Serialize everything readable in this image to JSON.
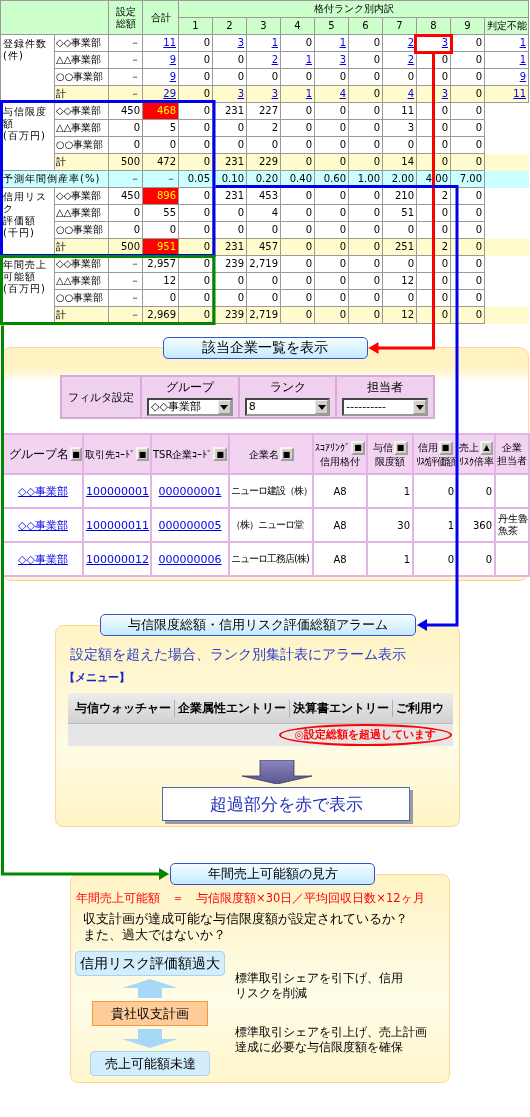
{
  "rank_table": {
    "columns": {
      "setting": "設定総額",
      "total": "合計",
      "breakdown": "格付ランク別内訳",
      "ranks": [
        "1",
        "2",
        "3",
        "4",
        "5",
        "6",
        "7",
        "8",
        "9",
        "判定不能"
      ]
    },
    "sections": [
      {
        "kind": "group",
        "label": [
          "登録件数",
          "(件)"
        ],
        "rows": [
          {
            "dept": "◇◇事業部",
            "subtotal": false,
            "cells": [
              "－",
              {
                "text": "11",
                "link": true
              },
              "0",
              {
                "text": "3",
                "link": true
              },
              {
                "text": "1",
                "link": true
              },
              "0",
              {
                "text": "1",
                "link": true
              },
              "0",
              {
                "text": "2",
                "link": true
              },
              {
                "text": "3",
                "link": true
              },
              "0",
              {
                "text": "1",
                "link": true
              }
            ]
          },
          {
            "dept": "△△事業部",
            "subtotal": false,
            "cells": [
              "－",
              {
                "text": "9",
                "link": true
              },
              "0",
              "0",
              {
                "text": "2",
                "link": true
              },
              {
                "text": "1",
                "link": true
              },
              {
                "text": "3",
                "link": true
              },
              "0",
              {
                "text": "2",
                "link": true
              },
              "0",
              "0",
              {
                "text": "1",
                "link": true
              }
            ]
          },
          {
            "dept": "○○事業部",
            "subtotal": false,
            "cells": [
              "－",
              {
                "text": "9",
                "link": true
              },
              "0",
              "0",
              "0",
              "0",
              "0",
              "0",
              "0",
              "0",
              "0",
              {
                "text": "9",
                "link": true
              }
            ]
          },
          {
            "dept": "計",
            "subtotal": true,
            "cells": [
              "－",
              {
                "text": "29",
                "link": true
              },
              "0",
              {
                "text": "3",
                "link": true
              },
              {
                "text": "3",
                "link": true
              },
              {
                "text": "1",
                "link": true
              },
              {
                "text": "4",
                "link": true
              },
              "0",
              {
                "text": "4",
                "link": true
              },
              {
                "text": "3",
                "link": true
              },
              "0",
              {
                "text": "11",
                "link": true
              }
            ]
          }
        ]
      },
      {
        "kind": "group",
        "label": [
          "与信限度額",
          "(百万円)"
        ],
        "rows": [
          {
            "dept": "◇◇事業部",
            "subtotal": false,
            "cells": [
              "450",
              {
                "text": "468",
                "alert": true
              },
              "0",
              "231",
              "227",
              "0",
              "0",
              "0",
              "11",
              "0",
              "0"
            ]
          },
          {
            "dept": "△△事業部",
            "subtotal": false,
            "cells": [
              "0",
              "5",
              "0",
              "0",
              "2",
              "0",
              "0",
              "0",
              "3",
              "0",
              "0"
            ]
          },
          {
            "dept": "○○事業部",
            "subtotal": false,
            "cells": [
              "0",
              "0",
              "0",
              "0",
              "0",
              "0",
              "0",
              "0",
              "0",
              "0",
              "0"
            ]
          },
          {
            "dept": "計",
            "subtotal": true,
            "cells": [
              "500",
              "472",
              "0",
              "231",
              "229",
              "0",
              "0",
              "0",
              "14",
              "0",
              "0"
            ]
          }
        ]
      },
      {
        "kind": "rate",
        "label": "予測年間倒産率(%)",
        "cells": [
          "－",
          "－",
          "0.05",
          "0.10",
          "0.20",
          "0.40",
          "0.60",
          "1.00",
          "2.00",
          "4.00",
          "7.00"
        ]
      },
      {
        "kind": "group",
        "label": [
          "信用リスク",
          "評価額",
          "(千円)"
        ],
        "rows": [
          {
            "dept": "◇◇事業部",
            "subtotal": false,
            "cells": [
              "450",
              {
                "text": "896",
                "alert": true
              },
              "0",
              "231",
              "453",
              "0",
              "0",
              "0",
              "210",
              "2",
              "0"
            ]
          },
          {
            "dept": "△△事業部",
            "subtotal": false,
            "cells": [
              "0",
              "55",
              "0",
              "0",
              "4",
              "0",
              "0",
              "0",
              "51",
              "0",
              "0"
            ]
          },
          {
            "dept": "○○事業部",
            "subtotal": false,
            "cells": [
              "0",
              "0",
              "0",
              "0",
              "0",
              "0",
              "0",
              "0",
              "0",
              "0",
              "0"
            ]
          },
          {
            "dept": "計",
            "subtotal": true,
            "cells": [
              "500",
              {
                "text": "951",
                "alert": true
              },
              "0",
              "231",
              "457",
              "0",
              "0",
              "0",
              "251",
              "2",
              "0"
            ]
          }
        ]
      },
      {
        "kind": "group",
        "label": [
          "年間売上",
          "可能額",
          "(百万円)"
        ],
        "rows": [
          {
            "dept": "◇◇事業部",
            "subtotal": false,
            "cells": [
              "－",
              "2,957",
              "0",
              "239",
              "2,719",
              "0",
              "0",
              "0",
              "0",
              "0",
              "0"
            ]
          },
          {
            "dept": "△△事業部",
            "subtotal": false,
            "cells": [
              "－",
              "12",
              "0",
              "0",
              "0",
              "0",
              "0",
              "0",
              "12",
              "0",
              "0"
            ]
          },
          {
            "dept": "○○事業部",
            "subtotal": false,
            "cells": [
              "－",
              "0",
              "0",
              "0",
              "0",
              "0",
              "0",
              "0",
              "0",
              "0",
              "0"
            ]
          },
          {
            "dept": "計",
            "subtotal": true,
            "cells": [
              "－",
              "2,969",
              "0",
              "239",
              "2,719",
              "0",
              "0",
              "0",
              "12",
              "0",
              "0"
            ]
          }
        ]
      }
    ]
  },
  "company_list": {
    "title": "該当企業一覧を表示",
    "filter": {
      "label": "フィルタ設定",
      "fields": [
        {
          "label": "グループ",
          "value": "◇◇事業部"
        },
        {
          "label": "ランク",
          "value": "8"
        },
        {
          "label": "担当者",
          "value": "----------"
        }
      ]
    },
    "columns": [
      {
        "lines": [
          "グループ名"
        ],
        "sort": "■"
      },
      {
        "lines": [
          "取引先ｺｰﾄﾞ"
        ],
        "sort": "■"
      },
      {
        "lines": [
          "TSR企業ｺｰﾄﾞ"
        ],
        "sort": "■"
      },
      {
        "lines": [
          "企業名"
        ],
        "sort": "■"
      },
      {
        "lines": [
          "ｽｺｱﾘﾝｸﾞ",
          "信用格付"
        ],
        "sort": "■"
      },
      {
        "lines": [
          "与信",
          "限度額"
        ],
        "sort": "■"
      },
      {
        "lines": [
          "信用",
          "ﾘｽｸ評価額"
        ],
        "sort": "■"
      },
      {
        "lines": [
          "売上",
          "ﾘｽｸ倍率"
        ],
        "sort": "▲"
      },
      {
        "lines": [
          "企業",
          "担当者"
        ]
      }
    ],
    "rows": [
      [
        {
          "text": "◇◇事業部",
          "link": true
        },
        {
          "text": "100000001",
          "link": true
        },
        {
          "text": "000000001",
          "link": true
        },
        "ニューロ建設（株）",
        "A8",
        "1",
        "0",
        "0"
      ],
      [
        {
          "text": "◇◇事業部",
          "link": true
        },
        {
          "text": "100000011",
          "link": true
        },
        {
          "text": "000000005",
          "link": true
        },
        "（株）ニューロ堂",
        "A8",
        "30",
        "1",
        "360",
        "丹生魯魚茶"
      ],
      [
        {
          "text": "◇◇事業部",
          "link": true
        },
        {
          "text": "100000012",
          "link": true
        },
        {
          "text": "000000006",
          "link": true
        },
        "ニューロ工務店(株)",
        "A8",
        "1",
        "0",
        "0"
      ]
    ]
  },
  "alarm": {
    "title": "与信限度総額・信用リスク評価総額アラーム",
    "description": "設定額を超えた場合、ランク別集計表にアラーム表示",
    "menu_label": "【メニュー】",
    "menu_items": [
      "与信ウォッチャー",
      "企業属性エントリー",
      "決算書エントリー",
      "ご利用ウ"
    ],
    "alert": "◎設定総額を超過しています",
    "result": "超過部分を赤で表示"
  },
  "sales_view": {
    "title": "年間売上可能額の見方",
    "formula": "年間売上可能額　＝　与信限度額×30日／平均回収日数×12ヶ月",
    "question": [
      "収支計画が達成可能な与信限度額が設定されているか？",
      "また、過大ではないか？"
    ],
    "flow": {
      "top": "信用リスク評価額過大",
      "center": "貴社収支計画",
      "bottom": "売上可能額未達"
    },
    "notes": [
      [
        "標準取引シェアを引下げ、信用",
        "リスクを削減"
      ],
      [
        "標準取引シェアを引上げ、売上計画",
        "達成に必要な与信限度額を確保"
      ]
    ]
  }
}
